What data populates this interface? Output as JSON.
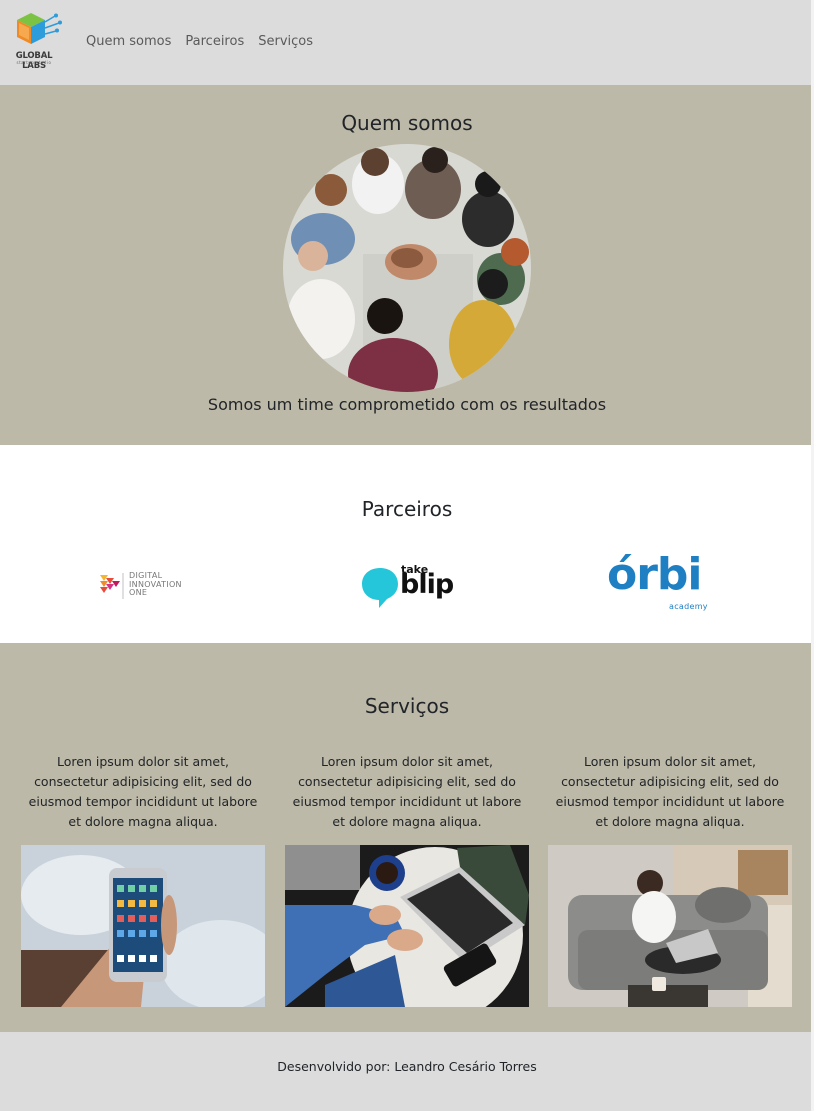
{
  "header": {
    "logo_text": "GLOBAL LABS",
    "logo_subtext": "startup studio",
    "nav": [
      {
        "label": "Quem somos"
      },
      {
        "label": "Parceiros"
      },
      {
        "label": "Serviços"
      }
    ]
  },
  "about": {
    "title": "Quem somos",
    "tagline": "Somos um time comprometido com os resultados"
  },
  "partners": {
    "title": "Parceiros",
    "logos": [
      {
        "name": "DIGITAL INNOVATION ONE",
        "lines": [
          "DIGITAL",
          "INNOVATION",
          "ONE"
        ]
      },
      {
        "name": "take blip",
        "top": "take",
        "main": "blip"
      },
      {
        "name": "órbi academy",
        "main": "órbi",
        "sub": "academy"
      }
    ]
  },
  "services": {
    "title": "Serviços",
    "items": [
      {
        "text": "Loren ipsum dolor sit amet, consectetur adipisicing elit, sed do eiusmod tempor incididunt ut labore et dolore magna aliqua."
      },
      {
        "text": "Loren ipsum dolor sit amet, consectetur adipisicing elit, sed do eiusmod tempor incididunt ut labore et dolore magna aliqua."
      },
      {
        "text": "Loren ipsum dolor sit amet, consectetur adipisicing elit, sed do eiusmod tempor incididunt ut labore et dolore magna aliqua."
      }
    ]
  },
  "footer": {
    "text": "Desenvolvido por: Leandro Cesário Torres"
  },
  "colors": {
    "header_bg": "#dcdcdc",
    "section_bg": "#bdb9a8",
    "partners_bg": "#ffffff",
    "blip_teal": "#26c6da",
    "orbi_blue": "#1e7fc2"
  }
}
